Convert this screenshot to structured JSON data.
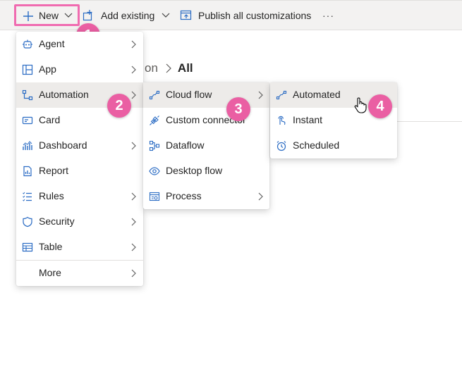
{
  "toolbar": {
    "new_label": "New",
    "add_existing_label": "Add existing",
    "publish_label": "Publish all customizations",
    "more_label": "···"
  },
  "breadcrumb": {
    "previous": "on",
    "current": "All"
  },
  "badges": {
    "b1": "1",
    "b2": "2",
    "b3": "3",
    "b4": "4"
  },
  "menu_new": {
    "items": [
      {
        "label": "Agent",
        "icon": "agent-icon",
        "submenu": true
      },
      {
        "label": "App",
        "icon": "app-icon",
        "submenu": true
      },
      {
        "label": "Automation",
        "icon": "automation-icon",
        "submenu": true,
        "selected": true
      },
      {
        "label": "Card",
        "icon": "card-icon",
        "submenu": false
      },
      {
        "label": "Dashboard",
        "icon": "dashboard-icon",
        "submenu": true
      },
      {
        "label": "Report",
        "icon": "report-icon",
        "submenu": false
      },
      {
        "label": "Rules",
        "icon": "rules-icon",
        "submenu": true
      },
      {
        "label": "Security",
        "icon": "shield-icon",
        "submenu": true
      },
      {
        "label": "Table",
        "icon": "table-icon",
        "submenu": true
      },
      {
        "label": "More",
        "icon": "",
        "submenu": true
      }
    ]
  },
  "menu_automation": {
    "items": [
      {
        "label": "Cloud flow",
        "icon": "cloud-flow-icon",
        "submenu": true,
        "selected": true
      },
      {
        "label": "Custom connector",
        "icon": "connector-icon",
        "submenu": false
      },
      {
        "label": "Dataflow",
        "icon": "dataflow-icon",
        "submenu": false
      },
      {
        "label": "Desktop flow",
        "icon": "desktop-flow-icon",
        "submenu": false
      },
      {
        "label": "Process",
        "icon": "process-icon",
        "submenu": true
      }
    ]
  },
  "menu_cloud_flow": {
    "items": [
      {
        "label": "Automated",
        "icon": "automated-icon",
        "selected": true
      },
      {
        "label": "Instant",
        "icon": "touch-icon"
      },
      {
        "label": "Scheduled",
        "icon": "clock-icon"
      }
    ]
  },
  "colors": {
    "accent": "#2b6cc4",
    "badge": "#ea5fa3",
    "highlight_border": "#f06bb0",
    "selected_bg": "#edebe9"
  }
}
